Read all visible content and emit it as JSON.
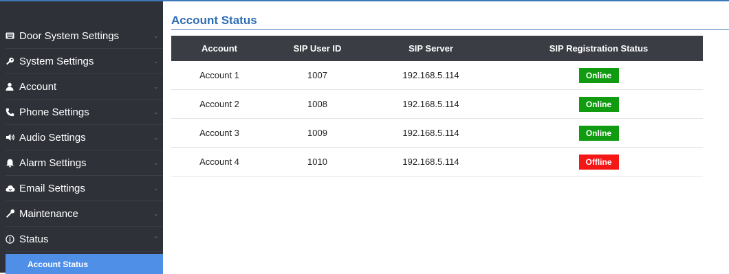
{
  "sidebar": {
    "items": [
      {
        "label": "Door System Settings",
        "icon": "keyboard-icon"
      },
      {
        "label": "System Settings",
        "icon": "key-icon"
      },
      {
        "label": "Account",
        "icon": "user-icon"
      },
      {
        "label": "Phone Settings",
        "icon": "phone-icon"
      },
      {
        "label": "Audio Settings",
        "icon": "speaker-icon"
      },
      {
        "label": "Alarm Settings",
        "icon": "bell-icon"
      },
      {
        "label": "Email Settings",
        "icon": "cloud-icon"
      },
      {
        "label": "Maintenance",
        "icon": "wrench-icon"
      },
      {
        "label": "Status",
        "icon": "info-icon"
      }
    ],
    "active_sub": "Account Status"
  },
  "main": {
    "title": "Account Status",
    "table": {
      "columns": [
        "Account",
        "SIP User ID",
        "SIP Server",
        "SIP Registration Status"
      ],
      "rows": [
        {
          "account": "Account 1",
          "user_id": "1007",
          "server": "192.168.5.114",
          "status": "Online"
        },
        {
          "account": "Account 2",
          "user_id": "1008",
          "server": "192.168.5.114",
          "status": "Online"
        },
        {
          "account": "Account 3",
          "user_id": "1009",
          "server": "192.168.5.114",
          "status": "Online"
        },
        {
          "account": "Account 4",
          "user_id": "1010",
          "server": "192.168.5.114",
          "status": "Offline"
        }
      ]
    }
  },
  "colors": {
    "online": "#119b11",
    "offline": "#f51616",
    "accent": "#2d6cb3",
    "sidebar_bg": "#2e3138",
    "active_sub_bg": "#4f8fe8"
  }
}
